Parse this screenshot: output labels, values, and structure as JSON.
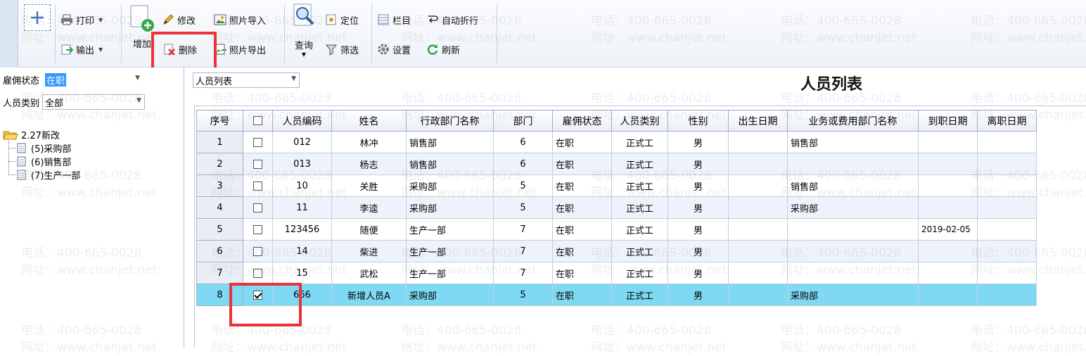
{
  "toolbar": {
    "print": "打印",
    "export": "输出",
    "add": "增加",
    "modify": "修改",
    "delete": "删除",
    "photo_import": "照片导入",
    "photo_export": "照片导出",
    "query": "查询",
    "locate": "定位",
    "filter": "筛选",
    "columns": "栏目",
    "auto_wrap": "自动折行",
    "settings": "设置",
    "refresh": "刷新"
  },
  "left": {
    "employment_status_label": "雇佣状态",
    "employment_status_value": "在职",
    "person_type_label": "人员类别",
    "person_type_value": "全部",
    "tree": {
      "root": "2.27新改",
      "children": [
        "(5)采购部",
        "(6)销售部",
        "(7)生产一部"
      ]
    }
  },
  "main": {
    "view_select": "人员列表",
    "title": "人员列表",
    "columns": [
      "序号",
      "",
      "人员编码",
      "姓名",
      "行政部门名称",
      "部门",
      "雇佣状态",
      "人员类别",
      "性别",
      "出生日期",
      "业务或费用部门名称",
      "到职日期",
      "离职日期"
    ],
    "rows": [
      {
        "no": "1",
        "checked": false,
        "code": "012",
        "name": "林冲",
        "admin_dept": "销售部",
        "dept": "6",
        "status": "在职",
        "type": "正式工",
        "gender": "男",
        "birth": "",
        "biz_dept": "销售部",
        "hire_date": "",
        "leave_date": ""
      },
      {
        "no": "2",
        "checked": false,
        "code": "013",
        "name": "杨志",
        "admin_dept": "销售部",
        "dept": "6",
        "status": "在职",
        "type": "正式工",
        "gender": "男",
        "birth": "",
        "biz_dept": "",
        "hire_date": "",
        "leave_date": ""
      },
      {
        "no": "3",
        "checked": false,
        "code": "10",
        "name": "关胜",
        "admin_dept": "采购部",
        "dept": "5",
        "status": "在职",
        "type": "正式工",
        "gender": "男",
        "birth": "",
        "biz_dept": "销售部",
        "hire_date": "",
        "leave_date": ""
      },
      {
        "no": "4",
        "checked": false,
        "code": "11",
        "name": "李逵",
        "admin_dept": "采购部",
        "dept": "5",
        "status": "在职",
        "type": "正式工",
        "gender": "男",
        "birth": "",
        "biz_dept": "采购部",
        "hire_date": "",
        "leave_date": ""
      },
      {
        "no": "5",
        "checked": false,
        "code": "123456",
        "name": "随便",
        "admin_dept": "生产一部",
        "dept": "7",
        "status": "在职",
        "type": "正式工",
        "gender": "男",
        "birth": "",
        "biz_dept": "",
        "hire_date": "2019-02-05",
        "leave_date": ""
      },
      {
        "no": "6",
        "checked": false,
        "code": "14",
        "name": "柴进",
        "admin_dept": "生产一部",
        "dept": "7",
        "status": "在职",
        "type": "正式工",
        "gender": "男",
        "birth": "",
        "biz_dept": "",
        "hire_date": "",
        "leave_date": ""
      },
      {
        "no": "7",
        "checked": false,
        "code": "15",
        "name": "武松",
        "admin_dept": "生产一部",
        "dept": "7",
        "status": "在职",
        "type": "正式工",
        "gender": "男",
        "birth": "",
        "biz_dept": "",
        "hire_date": "",
        "leave_date": ""
      },
      {
        "no": "8",
        "checked": true,
        "code": "666",
        "name": "新增人员A",
        "admin_dept": "采购部",
        "dept": "5",
        "status": "在职",
        "type": "正式工",
        "gender": "男",
        "birth": "",
        "biz_dept": "采购部",
        "hire_date": "",
        "leave_date": "",
        "selected": true
      }
    ]
  },
  "watermark": {
    "phone": "电话：400-665-0028",
    "site": "网址：www.chanjet.net"
  },
  "colors": {
    "selected_row": "#7fd9f2",
    "highlight_box": "#e8333c",
    "selection_text_bg": "#3399ff"
  }
}
